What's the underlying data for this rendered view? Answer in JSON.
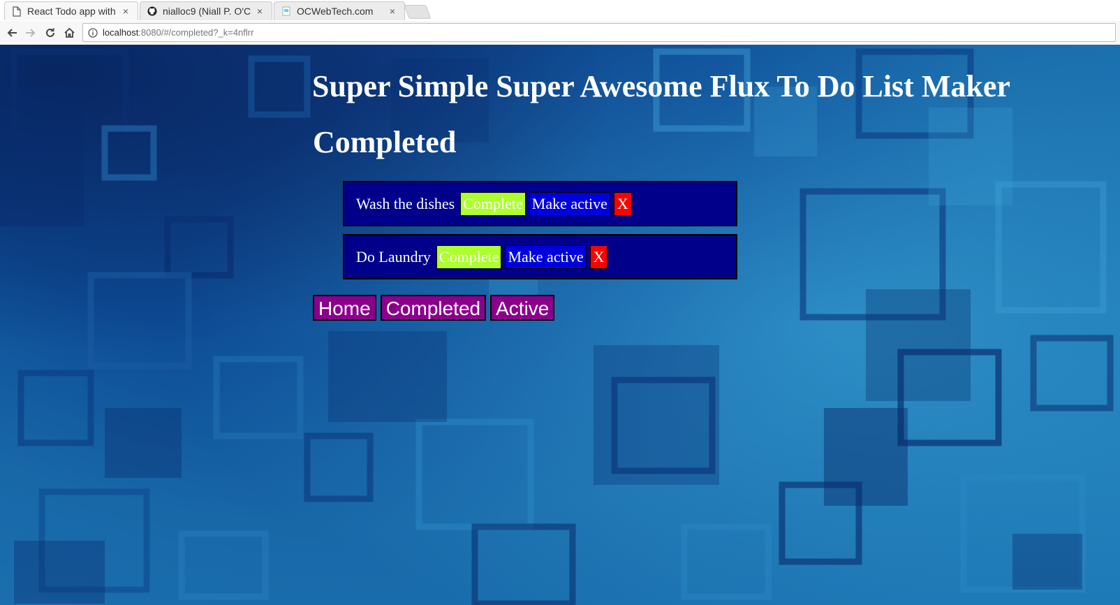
{
  "browser": {
    "tabs": [
      {
        "title": "React Todo app with",
        "icon": "document-icon",
        "active": true
      },
      {
        "title": "nialloc9 (Niall P. O'C",
        "icon": "github-icon",
        "active": false
      },
      {
        "title": "OCWebTech.com",
        "icon": "site-favicon-icon",
        "active": false
      }
    ],
    "close_glyph": "×",
    "url_host": "localhost",
    "url_rest": ":8080/#/completed?_k=4nflrr"
  },
  "app": {
    "title": "Super Simple Super Awesome Flux To Do List Maker",
    "page_heading": "Completed",
    "todos": [
      {
        "text": "Wash the dishes",
        "complete_label": "Complete",
        "make_active_label": "Make active",
        "delete_label": "X"
      },
      {
        "text": "Do Laundry",
        "complete_label": "Complete",
        "make_active_label": "Make active",
        "delete_label": "X"
      }
    ],
    "nav": {
      "home": "Home",
      "completed": "Completed",
      "active": "Active"
    }
  },
  "colors": {
    "item_bg": "#00008b",
    "complete_btn": "#adff2f",
    "make_active_btn": "#0000dd",
    "delete_btn": "#ff0000",
    "nav_bg": "#8b008b"
  }
}
